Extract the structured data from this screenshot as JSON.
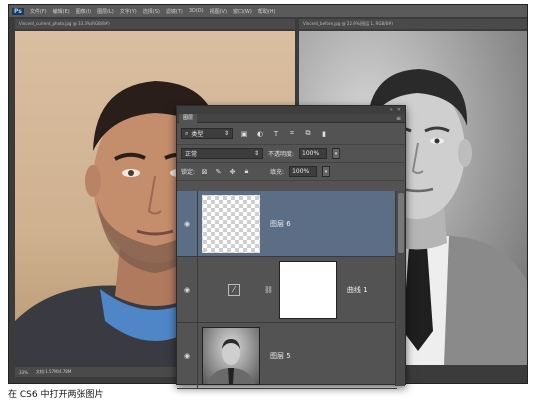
{
  "menubar": {
    "logo": "Ps",
    "items": [
      "文件(F)",
      "编辑(E)",
      "图像(I)",
      "图层(L)",
      "文字(Y)",
      "选择(S)",
      "滤镜(T)",
      "3D(D)",
      "视图(V)",
      "窗口(W)",
      "帮助(H)"
    ]
  },
  "documents": {
    "left_tab": "Vincent_current_photo.jpg @ 33.3%(RGB/8#)",
    "right_tab": "Vincent_before.jpg @ 22.9%(图层 1, RGB/8#)"
  },
  "statusbar": {
    "zoom": "33%",
    "doc_info": "文档:1.57M/4.78M"
  },
  "layers_panel": {
    "tab_label": "图层",
    "filter_label": "类型",
    "blend_mode": "正常",
    "opacity_label": "不透明度:",
    "opacity_value": "100%",
    "lock_label": "锁定:",
    "fill_label": "填充:",
    "fill_value": "100%",
    "layers": [
      {
        "name": "图层 6",
        "type": "transparent",
        "selected": true
      },
      {
        "name": "曲线 1",
        "type": "adjustment",
        "selected": false
      },
      {
        "name": "图层 5",
        "type": "photo",
        "selected": false
      }
    ]
  },
  "caption": {
    "text": "在 CS6 中打开两张图片"
  }
}
